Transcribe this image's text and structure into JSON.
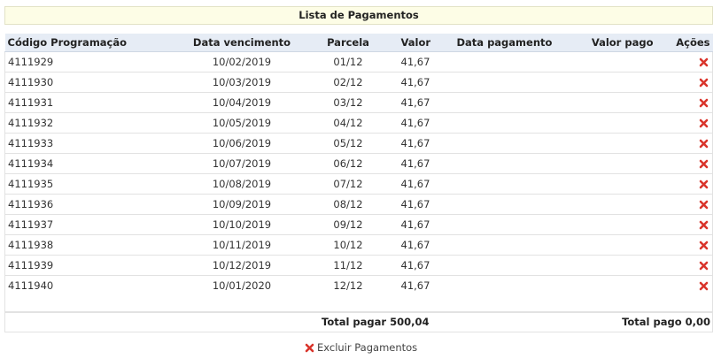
{
  "title": "Lista de Pagamentos",
  "columns": {
    "codigo": "Código Programação",
    "vencimento": "Data vencimento",
    "parcela": "Parcela",
    "valor": "Valor",
    "data_pagamento": "Data pagamento",
    "valor_pago": "Valor pago",
    "acoes": "Ações"
  },
  "rows": [
    {
      "codigo": "4111929",
      "vencimento": "10/02/2019",
      "parcela": "01/12",
      "valor": "41,67",
      "data_pagamento": "",
      "valor_pago": ""
    },
    {
      "codigo": "4111930",
      "vencimento": "10/03/2019",
      "parcela": "02/12",
      "valor": "41,67",
      "data_pagamento": "",
      "valor_pago": ""
    },
    {
      "codigo": "4111931",
      "vencimento": "10/04/2019",
      "parcela": "03/12",
      "valor": "41,67",
      "data_pagamento": "",
      "valor_pago": ""
    },
    {
      "codigo": "4111932",
      "vencimento": "10/05/2019",
      "parcela": "04/12",
      "valor": "41,67",
      "data_pagamento": "",
      "valor_pago": ""
    },
    {
      "codigo": "4111933",
      "vencimento": "10/06/2019",
      "parcela": "05/12",
      "valor": "41,67",
      "data_pagamento": "",
      "valor_pago": ""
    },
    {
      "codigo": "4111934",
      "vencimento": "10/07/2019",
      "parcela": "06/12",
      "valor": "41,67",
      "data_pagamento": "",
      "valor_pago": ""
    },
    {
      "codigo": "4111935",
      "vencimento": "10/08/2019",
      "parcela": "07/12",
      "valor": "41,67",
      "data_pagamento": "",
      "valor_pago": ""
    },
    {
      "codigo": "4111936",
      "vencimento": "10/09/2019",
      "parcela": "08/12",
      "valor": "41,67",
      "data_pagamento": "",
      "valor_pago": ""
    },
    {
      "codigo": "4111937",
      "vencimento": "10/10/2019",
      "parcela": "09/12",
      "valor": "41,67",
      "data_pagamento": "",
      "valor_pago": ""
    },
    {
      "codigo": "4111938",
      "vencimento": "10/11/2019",
      "parcela": "10/12",
      "valor": "41,67",
      "data_pagamento": "",
      "valor_pago": ""
    },
    {
      "codigo": "4111939",
      "vencimento": "10/12/2019",
      "parcela": "11/12",
      "valor": "41,67",
      "data_pagamento": "",
      "valor_pago": ""
    },
    {
      "codigo": "4111940",
      "vencimento": "10/01/2020",
      "parcela": "12/12",
      "valor": "41,67",
      "data_pagamento": "",
      "valor_pago": ""
    }
  ],
  "row_action_icon": "delete-x-icon",
  "totals": {
    "total_pagar": "Total pagar 500,04",
    "total_pago": "Total pago 0,00"
  },
  "footer": {
    "excluir_label": "Excluir Pagamentos",
    "excluir_icon": "delete-x-icon"
  },
  "colors": {
    "header_bg": "#e6ecf5",
    "title_bg": "#fdfde6",
    "delete_red": "#d9342b"
  }
}
